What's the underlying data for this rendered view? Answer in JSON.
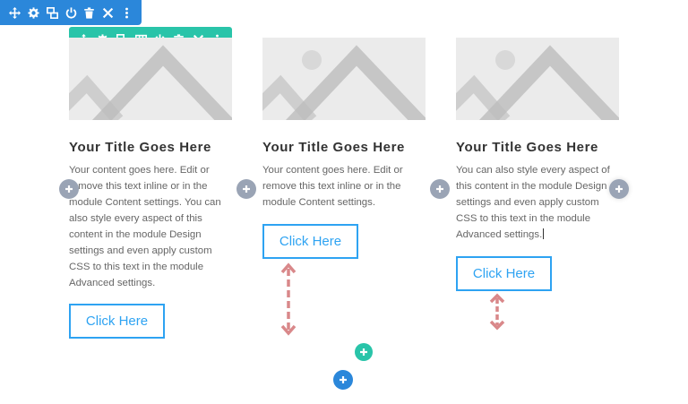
{
  "section_toolbar": {
    "icons": [
      "move-icon",
      "gear-icon",
      "duplicate-icon",
      "power-icon",
      "trash-icon",
      "close-icon",
      "more-icon"
    ]
  },
  "row_toolbar": {
    "icons": [
      "move-icon",
      "gear-icon",
      "duplicate-icon",
      "columns-icon",
      "power-icon",
      "trash-icon",
      "close-icon",
      "more-icon"
    ]
  },
  "columns": [
    {
      "title": "Your Title Goes Here",
      "body": "Your content goes here. Edit or remove this text inline or in the module Content settings. You can also style every aspect of this content in the module Design settings and even apply custom CSS to this text in the module Advanced settings.",
      "button_label": "Click Here"
    },
    {
      "title": "Your Title Goes Here",
      "body": "Your content goes here. Edit or remove this text inline or in the module Content settings.",
      "button_label": "Click Here"
    },
    {
      "title": "Your Title Goes Here",
      "body": "You can also style every aspect of this content in the module Design settings and even apply custom CSS to this text in the module Advanced settings.",
      "button_label": "Click Here"
    }
  ],
  "colors": {
    "section_blue": "#2b87da",
    "row_green": "#29c4a9",
    "button_blue": "#2ea3f2",
    "add_gray": "#9aa4b5",
    "arrow_red": "#d9888a"
  }
}
